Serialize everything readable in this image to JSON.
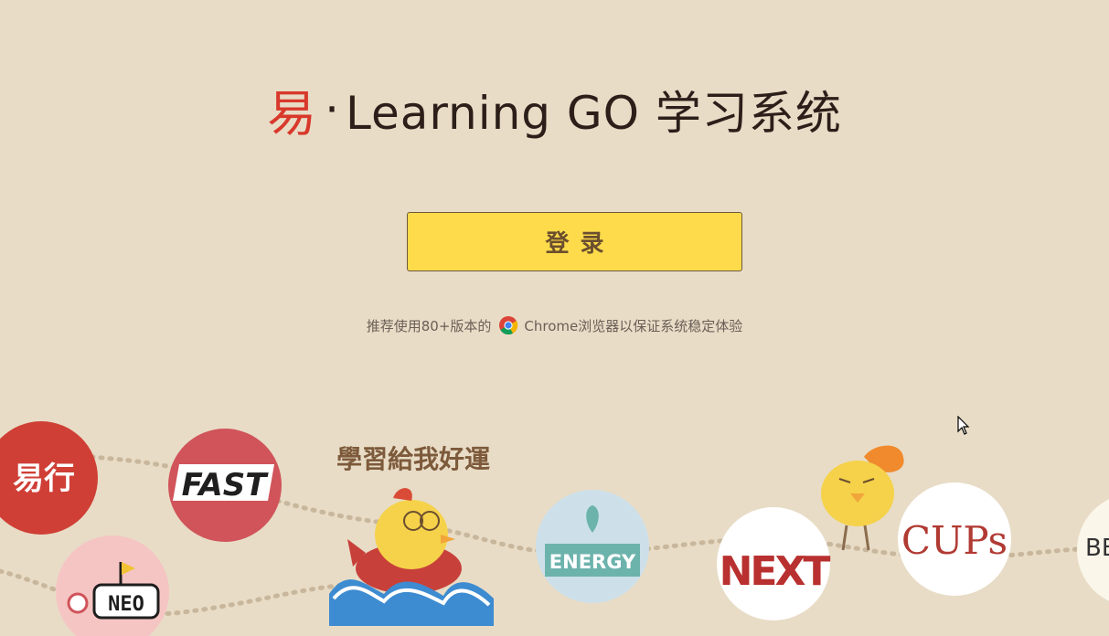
{
  "header": {
    "logo_char": "易",
    "separator": "·",
    "title": "Learning GO 学习系统"
  },
  "login": {
    "label": "登录"
  },
  "hint": {
    "before": "推荐使用80+版本的",
    "after": "Chrome浏览器以保证系统稳定体验"
  },
  "badges": {
    "fast": "FAST",
    "neo": "NEO",
    "energy": "ENERGY",
    "next": "NEXT",
    "cups": "CUPs",
    "be": "BE",
    "yikuo": "易行",
    "slogan": "學習給我好運"
  },
  "colors": {
    "background": "#e8dcc6",
    "accent": "#d8392b",
    "button": "#fddb4b"
  }
}
